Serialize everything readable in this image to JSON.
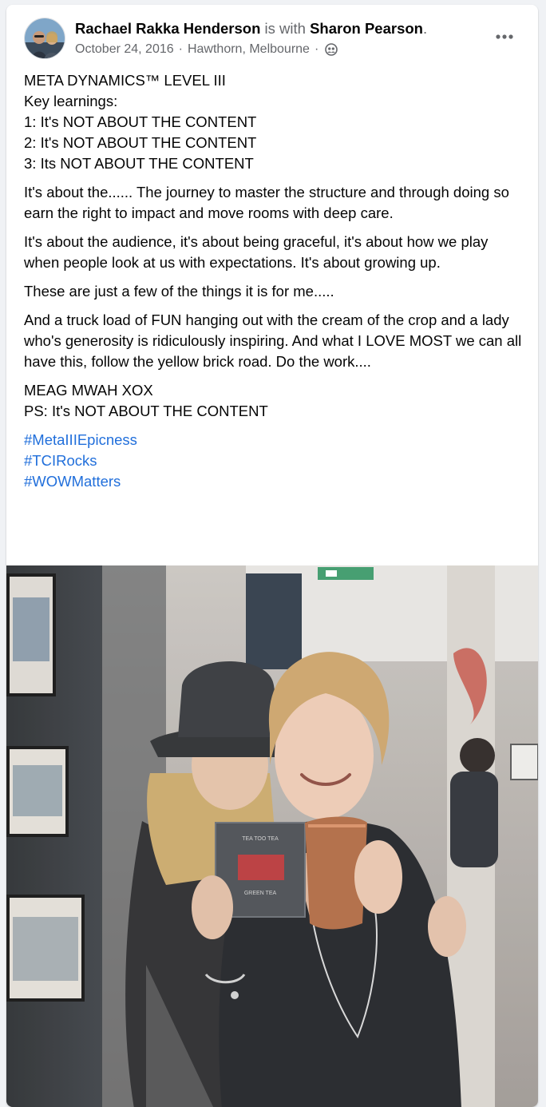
{
  "post": {
    "author": "Rachael Rakka Henderson",
    "with_text": "is with",
    "tagged": "Sharon Pearson",
    "tagged_suffix": ".",
    "date": "October 24, 2016",
    "separator": "·",
    "location": "Hawthorn, Melbourne",
    "privacy_icon": "friends-globe-icon",
    "more_icon": "more-horizontal-icon",
    "text": {
      "para1": [
        "META DYNAMICS™ LEVEL III",
        "Key learnings:",
        "1: It's NOT ABOUT THE CONTENT",
        "2: It's NOT ABOUT THE CONTENT",
        "3: Its NOT ABOUT THE CONTENT"
      ],
      "para2": "It's about the...... The journey to master the structure and through doing so earn the right to impact and move rooms with deep care.",
      "para3": "It's about the audience, it's about being graceful, it's about how we play when people look at us with expectations. It's about growing up.",
      "para4": "These are just a few of the things it is for me.....",
      "para5": "And a truck load of FUN hanging out with the cream of the crop and a lady who's generosity is ridiculously inspiring. And what I LOVE MOST we can all have this, follow the yellow brick road. Do the work....",
      "para6": [
        "MEAG MWAH XOX",
        "PS: It's NOT ABOUT THE CONTENT"
      ]
    },
    "hashtags": [
      "#MetaIIIEpicness",
      "#TCIRocks",
      "#WOWMatters"
    ],
    "photo_box_text": [
      "TEA TOO TEA",
      "GREEN TEA"
    ]
  },
  "colors": {
    "link": "#216fdb",
    "muted": "#65676b",
    "text": "#050505"
  }
}
